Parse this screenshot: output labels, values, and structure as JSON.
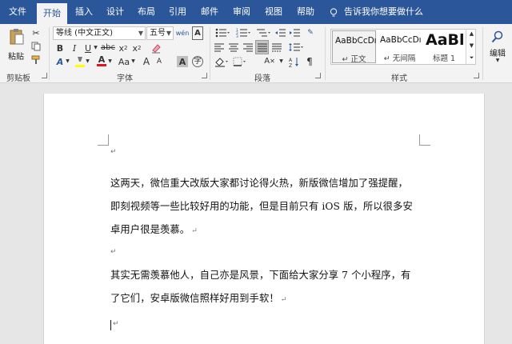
{
  "tabs": [
    "文件",
    "开始",
    "插入",
    "设计",
    "布局",
    "引用",
    "邮件",
    "审阅",
    "视图",
    "帮助"
  ],
  "tellme": "告诉我你想要做什么",
  "clipboard": {
    "paste": "粘贴",
    "label": "剪贴板"
  },
  "font": {
    "name": "等线 (中文正文)",
    "size": "五号",
    "label": "字体"
  },
  "paragraph": {
    "label": "段落"
  },
  "styles": {
    "label": "样式",
    "items": [
      {
        "sample": "AaBbCcDı",
        "name": "↵ 正文"
      },
      {
        "sample": "AaBbCcDı",
        "name": "↵ 无间隔"
      },
      {
        "sample": "AaBl",
        "name": "标题 1"
      }
    ]
  },
  "editing": {
    "label": "编辑"
  },
  "document": {
    "p1": [
      "这两天，微信重大改版大家都讨论得火热，新版微信增加了强提醒，",
      "即刻视频等一些比较好用的功能，但是目前只有 iOS 版，所以很多安",
      "卓用户很是羡慕。"
    ],
    "p2": [
      "其实无需羡慕他人，自己亦是风景，下面给大家分享 7 个小程序，有",
      "了它们，安卓版微信照样好用到手软！"
    ],
    "mark": "↵"
  },
  "colors": {
    "accent": "#2b579a",
    "highlight": "#ffff00",
    "font_red": "#e81123"
  }
}
